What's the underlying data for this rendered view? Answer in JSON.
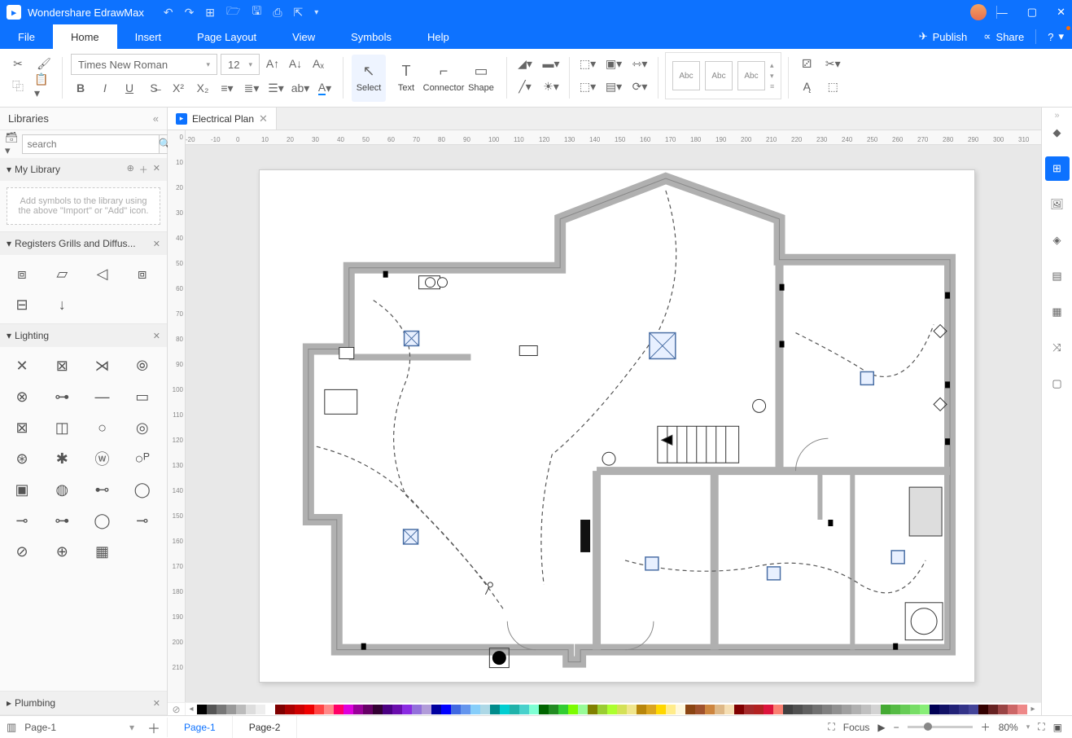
{
  "app": {
    "name": "Wondershare EdrawMax"
  },
  "menu": {
    "file": "File",
    "home": "Home",
    "insert": "Insert",
    "pagelayout": "Page Layout",
    "view": "View",
    "symbols": "Symbols",
    "help": "Help",
    "publish": "Publish",
    "share": "Share"
  },
  "ribbon": {
    "font": "Times New Roman",
    "size": "12",
    "select": "Select",
    "text": "Text",
    "connector": "Connector",
    "shape": "Shape",
    "style_label": "Abc"
  },
  "libraries": {
    "title": "Libraries",
    "search_placeholder": "search",
    "mylib": {
      "title": "My Library",
      "placeholder": "Add symbols to the library using the above \"Import\" or \"Add\" icon."
    },
    "registers": {
      "title": "Registers Grills and Diffus..."
    },
    "lighting": {
      "title": "Lighting"
    },
    "plumbing": {
      "title": "Plumbing"
    }
  },
  "document": {
    "tab_name": "Electrical Plan"
  },
  "pages": {
    "sel": "Page-1",
    "p1": "Page-1",
    "p2": "Page-2"
  },
  "status": {
    "focus": "Focus",
    "zoom": "80%"
  },
  "ruler_h": [
    "-20",
    "-10",
    "0",
    "10",
    "20",
    "30",
    "40",
    "50",
    "60",
    "70",
    "80",
    "90",
    "100",
    "110",
    "120",
    "130",
    "140",
    "150",
    "160",
    "170",
    "180",
    "190",
    "200",
    "210",
    "220",
    "230",
    "240",
    "250",
    "260",
    "270",
    "280",
    "290",
    "300",
    "310"
  ],
  "ruler_v": [
    "0",
    "10",
    "20",
    "30",
    "40",
    "50",
    "60",
    "70",
    "80",
    "90",
    "100",
    "110",
    "120",
    "130",
    "140",
    "150",
    "160",
    "170",
    "180",
    "190",
    "200",
    "210"
  ],
  "palette_colors": [
    "#000",
    "#555",
    "#777",
    "#999",
    "#bbb",
    "#ddd",
    "#eee",
    "#fff",
    "#7f0000",
    "#a00",
    "#c00",
    "#e00",
    "#f44",
    "#f88",
    "#f06",
    "#d0d",
    "#909",
    "#606",
    "#303",
    "#4b0082",
    "#6a0dad",
    "#8a2be2",
    "#9370db",
    "#b19cd9",
    "#0000a0",
    "#0000ff",
    "#4169e1",
    "#6495ed",
    "#87cefa",
    "#add8e6",
    "#008b8b",
    "#00ced1",
    "#20b2aa",
    "#48d1cc",
    "#7fffd4",
    "#006400",
    "#228b22",
    "#32cd32",
    "#7cfc00",
    "#98fb98",
    "#808000",
    "#9acd32",
    "#adff2f",
    "#d4e157",
    "#f0e68c",
    "#b8860b",
    "#daa520",
    "#ffd700",
    "#ffec8b",
    "#fff8dc",
    "#8b4513",
    "#a0522d",
    "#cd853f",
    "#deb887",
    "#f5deb3",
    "#800000",
    "#a52a2a",
    "#b22222",
    "#dc143c",
    "#fa8072",
    "#404040",
    "#505050",
    "#606060",
    "#707070",
    "#808080",
    "#909090",
    "#a0a0a0",
    "#b0b0b0",
    "#c0c0c0",
    "#d3d3d3",
    "#4a3",
    "#5b4",
    "#6c5",
    "#7d6",
    "#8e7",
    "#005",
    "#116",
    "#227",
    "#338",
    "#449",
    "#300",
    "#622",
    "#944",
    "#c66",
    "#e88"
  ]
}
